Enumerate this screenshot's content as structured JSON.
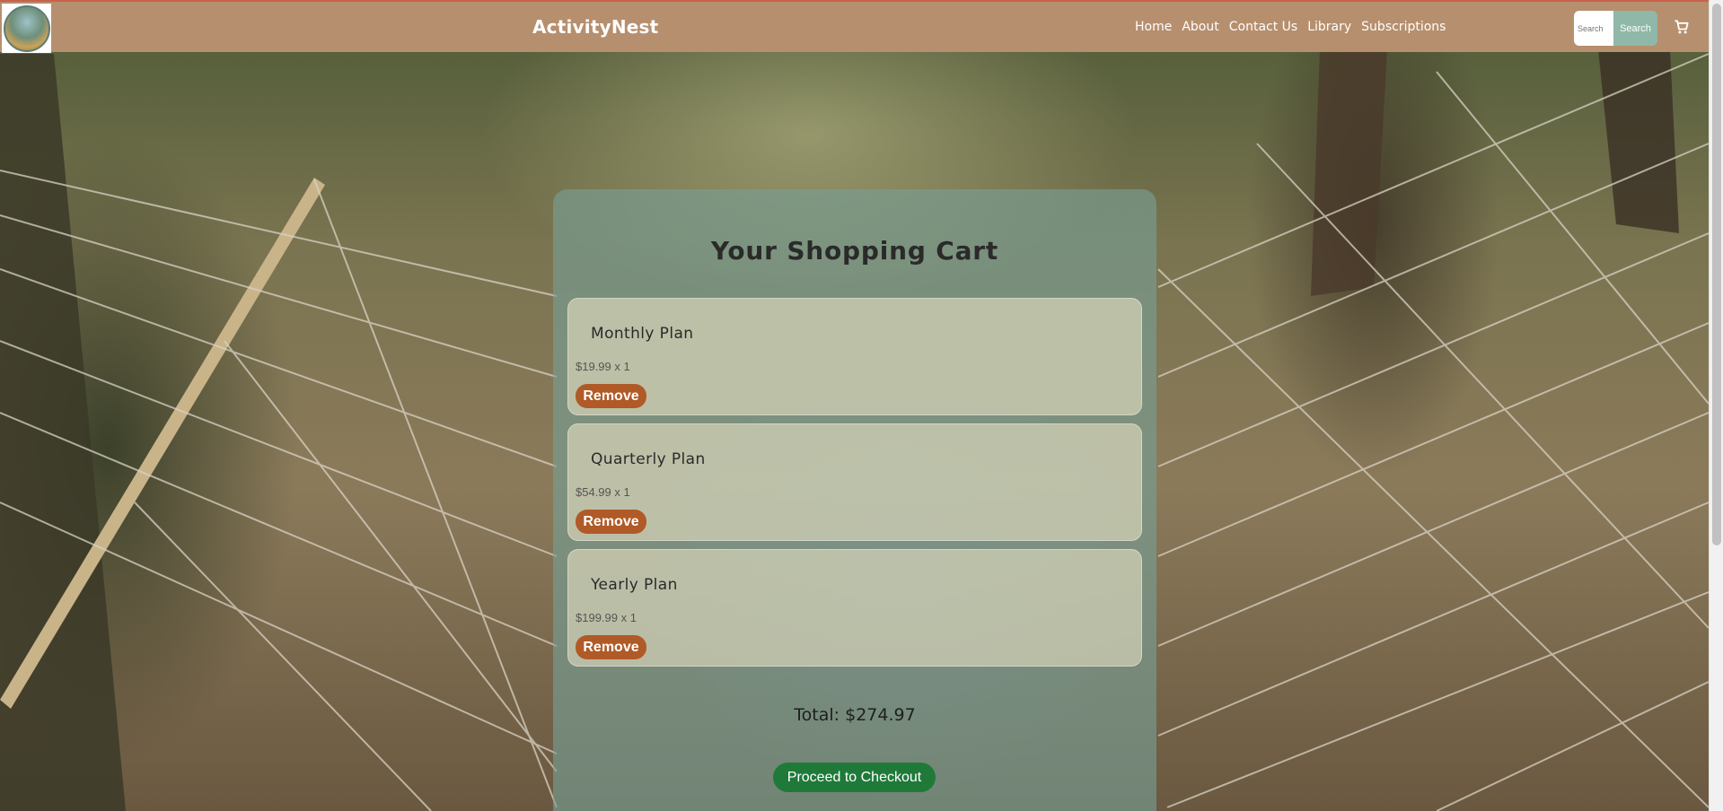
{
  "header": {
    "brand": "ActivityNest",
    "logo_icon": "logo-icon",
    "nav": [
      "Home",
      "About",
      "Contact Us",
      "Library",
      "Subscriptions"
    ],
    "search": {
      "placeholder": "Search",
      "button_label": "Search"
    },
    "cart_icon": "cart-icon"
  },
  "cart": {
    "title": "Your Shopping Cart",
    "items": [
      {
        "name": "Monthly Plan",
        "price_qty": "$19.99 x 1",
        "remove_label": "Remove"
      },
      {
        "name": "Quarterly Plan",
        "price_qty": "$54.99 x 1",
        "remove_label": "Remove"
      },
      {
        "name": "Yearly Plan",
        "price_qty": "$199.99 x 1",
        "remove_label": "Remove"
      }
    ],
    "total": "Total: $274.97",
    "checkout_label": "Proceed to Checkout"
  },
  "colors": {
    "header_bg": "#b68f6e",
    "accent_top": "#c8614c",
    "panel_bg": "#78a096",
    "remove_btn": "#b05a28",
    "checkout_btn": "#1f7a3a",
    "search_btn": "#8fb8a8"
  }
}
